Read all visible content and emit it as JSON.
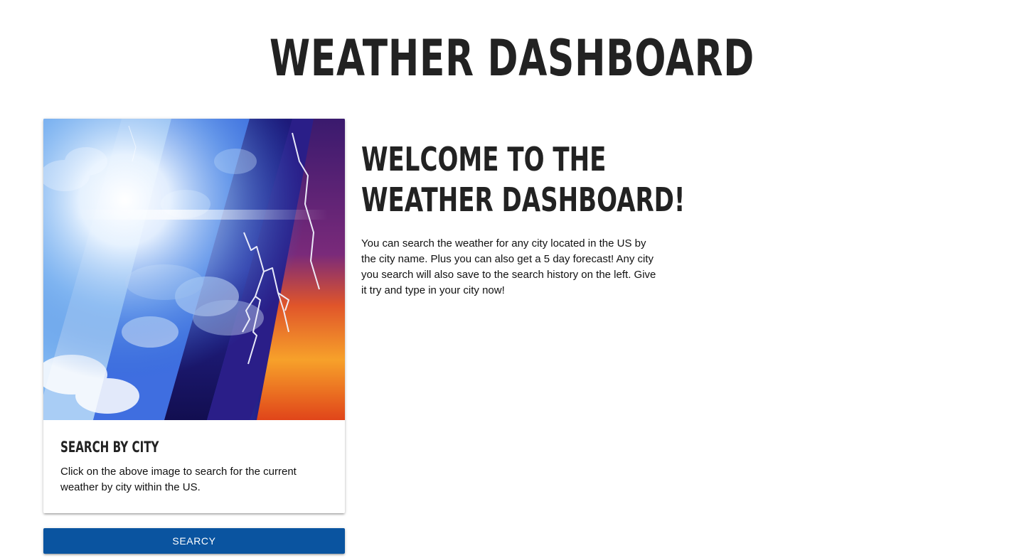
{
  "header": {
    "title": "WEATHER DASHBOARD"
  },
  "card": {
    "image_name": "weather-collage-image",
    "title": "Search by City",
    "text": "Click on the above image to search for the current weather by city within the US."
  },
  "search_button": {
    "label": "SEARCY",
    "color": "#0a54a0"
  },
  "welcome": {
    "heading_line1": "WELCOME TO THE",
    "heading_line2": "WEATHER DASHBOARD!",
    "text": "You can search the weather for any city located in the US by the city name. Plus you can also get a 5 day forecast! Any city you search will also save to the search history on the left. Give it try and type in your city now!"
  }
}
